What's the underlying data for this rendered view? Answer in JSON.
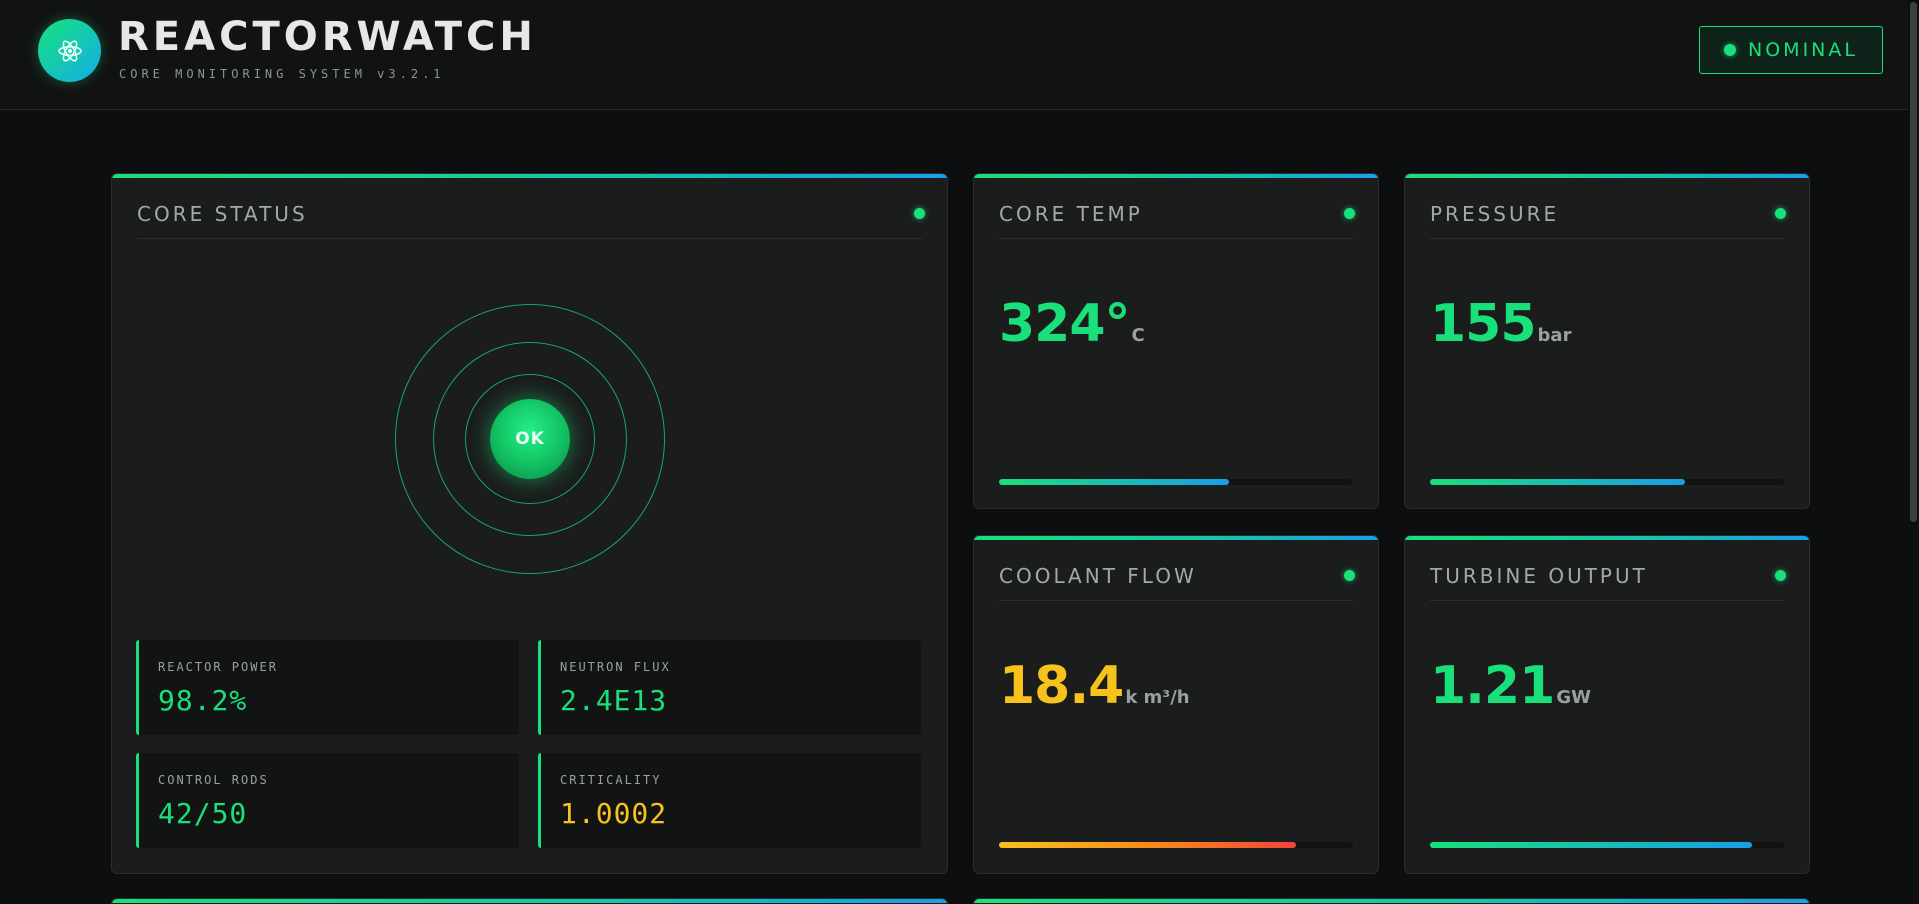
{
  "header": {
    "title": "REACTORWATCH",
    "subtitle": "CORE MONITORING SYSTEM v3.2.1",
    "logo_icon": "atom-icon",
    "status_label": "NOMINAL"
  },
  "colors": {
    "accent_green": "#19e07a",
    "accent_blue": "#1a9ee8",
    "warning_yellow": "#f7c21c",
    "background": "#0c0e0f",
    "panel": "#1b1c1c"
  },
  "core_status": {
    "title": "CORE STATUS",
    "core_label": "OK",
    "stats": [
      {
        "label": "REACTOR POWER",
        "value": "98.2%"
      },
      {
        "label": "NEUTRON FLUX",
        "value": "2.4E13"
      },
      {
        "label": "CONTROL RODS",
        "value": "42/50"
      },
      {
        "label": "CRITICALITY",
        "value": "1.0002"
      }
    ]
  },
  "metrics": [
    {
      "title": "CORE TEMP",
      "value": "324°",
      "unit": "C",
      "progress": 0.65
    },
    {
      "title": "PRESSURE",
      "value": "155",
      "unit": "bar",
      "progress": 0.72
    },
    {
      "title": "COOLANT FLOW",
      "value": "18.4",
      "unit": "k m³/h",
      "progress": 0.84
    },
    {
      "title": "TURBINE OUTPUT",
      "value": "1.21",
      "unit": "GW",
      "progress": 0.91
    }
  ]
}
